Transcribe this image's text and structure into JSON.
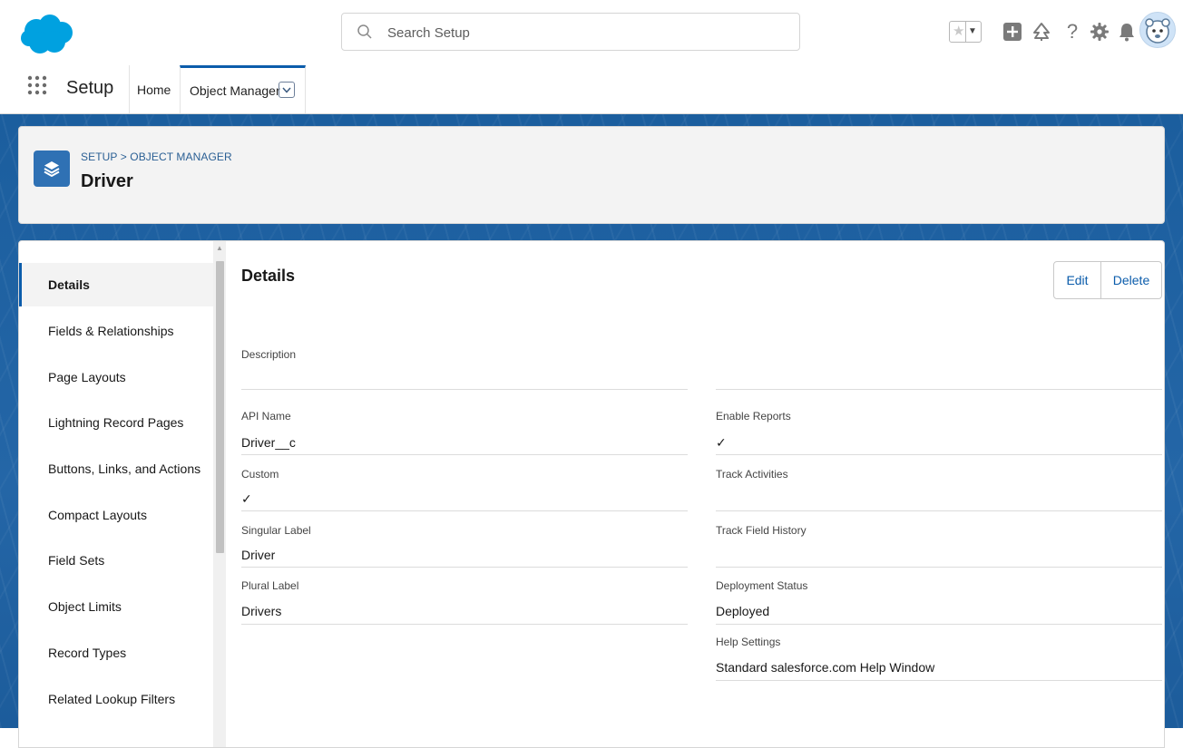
{
  "header": {
    "search_placeholder": "Search Setup",
    "icons": [
      "favorites-star-icon",
      "favorites-dropdown-icon",
      "global-add-icon",
      "trailhead-icon",
      "help-icon",
      "setup-gear-icon",
      "notifications-bell-icon",
      "user-avatar"
    ]
  },
  "nav": {
    "app_name": "Setup",
    "tabs": [
      {
        "label": "Home"
      },
      {
        "label": "Object Manager",
        "active": true
      }
    ]
  },
  "object_header": {
    "breadcrumb": "SETUP > OBJECT MANAGER",
    "title": "Driver"
  },
  "sidebar": {
    "items": [
      {
        "label": "Details",
        "active": true
      },
      {
        "label": "Fields & Relationships"
      },
      {
        "label": "Page Layouts"
      },
      {
        "label": "Lightning Record Pages"
      },
      {
        "label": "Buttons, Links, and Actions"
      },
      {
        "label": "Compact Layouts"
      },
      {
        "label": "Field Sets"
      },
      {
        "label": "Object Limits"
      },
      {
        "label": "Record Types"
      },
      {
        "label": "Related Lookup Filters"
      }
    ]
  },
  "details": {
    "title": "Details",
    "edit_label": "Edit",
    "delete_label": "Delete",
    "description": {
      "label": "Description",
      "value": ""
    },
    "left": [
      {
        "label": "API Name",
        "value": "Driver__c"
      },
      {
        "label": "Custom",
        "value": "✓"
      },
      {
        "label": "Singular Label",
        "value": "Driver"
      },
      {
        "label": "Plural Label",
        "value": "Drivers"
      }
    ],
    "right": [
      {
        "label": "Enable Reports",
        "value": "✓"
      },
      {
        "label": "Track Activities",
        "value": ""
      },
      {
        "label": "Track Field History",
        "value": ""
      },
      {
        "label": "Deployment Status",
        "value": "Deployed"
      },
      {
        "label": "Help Settings",
        "value": "Standard salesforce.com Help Window"
      }
    ]
  },
  "colors": {
    "brand_blue": "#00a1e0",
    "link_blue": "#0b5cab",
    "background_blue": "#1f5d9a"
  }
}
